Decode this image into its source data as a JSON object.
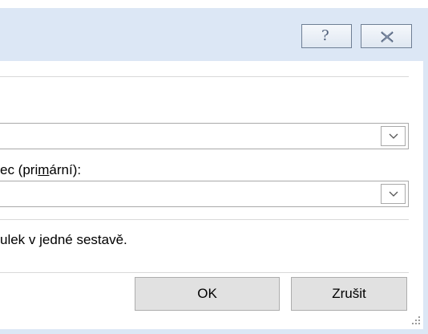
{
  "title_bar": {
    "help_glyph": "?",
    "help_icon": "question-mark-icon",
    "close_icon": "close-x-icon"
  },
  "primary_label": {
    "before_underline": "ec (pri",
    "underlined": "m",
    "after_underline": "ární):"
  },
  "combos": {
    "first_arrow": "chevron-down-icon",
    "second_arrow": "chevron-down-icon"
  },
  "info_text": "ulek v jedné sestavě.",
  "buttons": {
    "ok_label": "OK",
    "cancel_label": "Zrušit"
  },
  "colors": {
    "title_bar_bg": "#dce7f5",
    "button_bg": "#e1e1e1",
    "border": "#a9a9a9"
  }
}
